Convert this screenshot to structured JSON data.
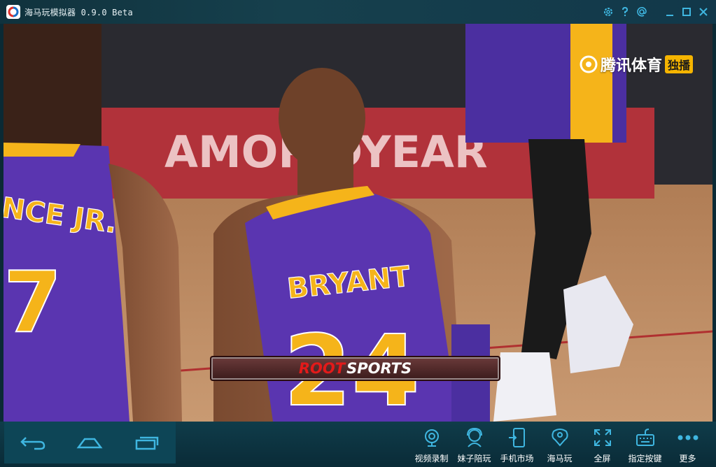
{
  "window": {
    "title": "海马玩模拟器 0.9.0 Beta"
  },
  "title_tools": [
    "gear-icon",
    "help-icon",
    "at-icon",
    "minimize-icon",
    "maximize-icon",
    "close-icon"
  ],
  "video": {
    "broadcaster": {
      "name": "腾讯体育",
      "badge": "独播"
    },
    "ticker": {
      "part1": "ROOT",
      "part2": "SPORTS"
    },
    "jerseys": {
      "left_name": "NCE JR.",
      "left_number": "7",
      "center_name": "BRYANT",
      "center_number": "24"
    },
    "banner_text": "AMOR      DYEAR"
  },
  "nav": [
    "back-icon",
    "home-icon",
    "recent-apps-icon"
  ],
  "tools": [
    {
      "label": "视频录制",
      "icon": "video-record-icon"
    },
    {
      "label": "妹子陪玩",
      "icon": "companion-icon"
    },
    {
      "label": "手机市场",
      "icon": "app-market-icon"
    },
    {
      "label": "海马玩",
      "icon": "haimawan-icon"
    },
    {
      "label": "全屏",
      "icon": "fullscreen-icon"
    },
    {
      "label": "指定按键",
      "icon": "keymap-icon"
    },
    {
      "label": "更多",
      "icon": "more-icon"
    }
  ],
  "colors": {
    "accent": "#3fb6e0",
    "lakers_purple": "#5a35b0",
    "lakers_gold": "#f5b41a"
  }
}
